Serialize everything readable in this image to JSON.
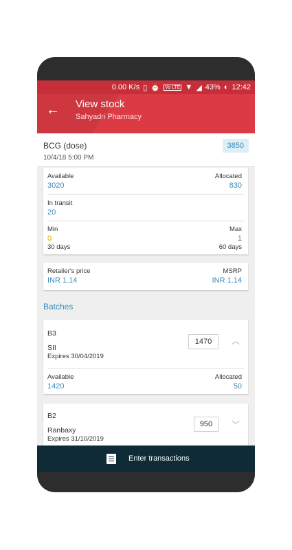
{
  "status_bar": {
    "net_speed": "0.00 K/s",
    "battery": "43%",
    "time": "12:42",
    "lte": "Vo LTE"
  },
  "app_bar": {
    "title": "View stock",
    "subtitle": "Sahyadri Pharmacy"
  },
  "product": {
    "name": "BCG (dose)",
    "date": "10/4/18 5:00 PM",
    "quantity": "3850"
  },
  "stock": {
    "available_label": "Available",
    "available_value": "3020",
    "allocated_label": "Allocated",
    "allocated_value": "830",
    "transit_label": "In transit",
    "transit_value": "20",
    "min_label": "Min",
    "min_value": "0",
    "min_days": "30 days",
    "max_label": "Max",
    "max_value": "1",
    "max_days": "60 days"
  },
  "price": {
    "retailer_label": "Retailer's price",
    "retailer_value": "INR 1.14",
    "msrp_label": "MSRP",
    "msrp_value": "INR 1.14"
  },
  "batches_title": "Batches",
  "batches": [
    {
      "id": "B3",
      "maker": "SII",
      "expires": "Expires 30/04/2019",
      "quantity": "1470",
      "available_label": "Available",
      "available_value": "1420",
      "allocated_label": "Allocated",
      "allocated_value": "50"
    },
    {
      "id": "B2",
      "maker": "Ranbaxy",
      "expires": "Expires 31/10/2019",
      "quantity": "950"
    }
  ],
  "bottom_button": {
    "label": "Enter transactions",
    "icon": "document-icon"
  },
  "colors": {
    "appbar": "#dc3b45",
    "accent_blue": "#3a8cba",
    "min_orange": "#e6a800",
    "bottom_bar": "#0f2b36"
  }
}
